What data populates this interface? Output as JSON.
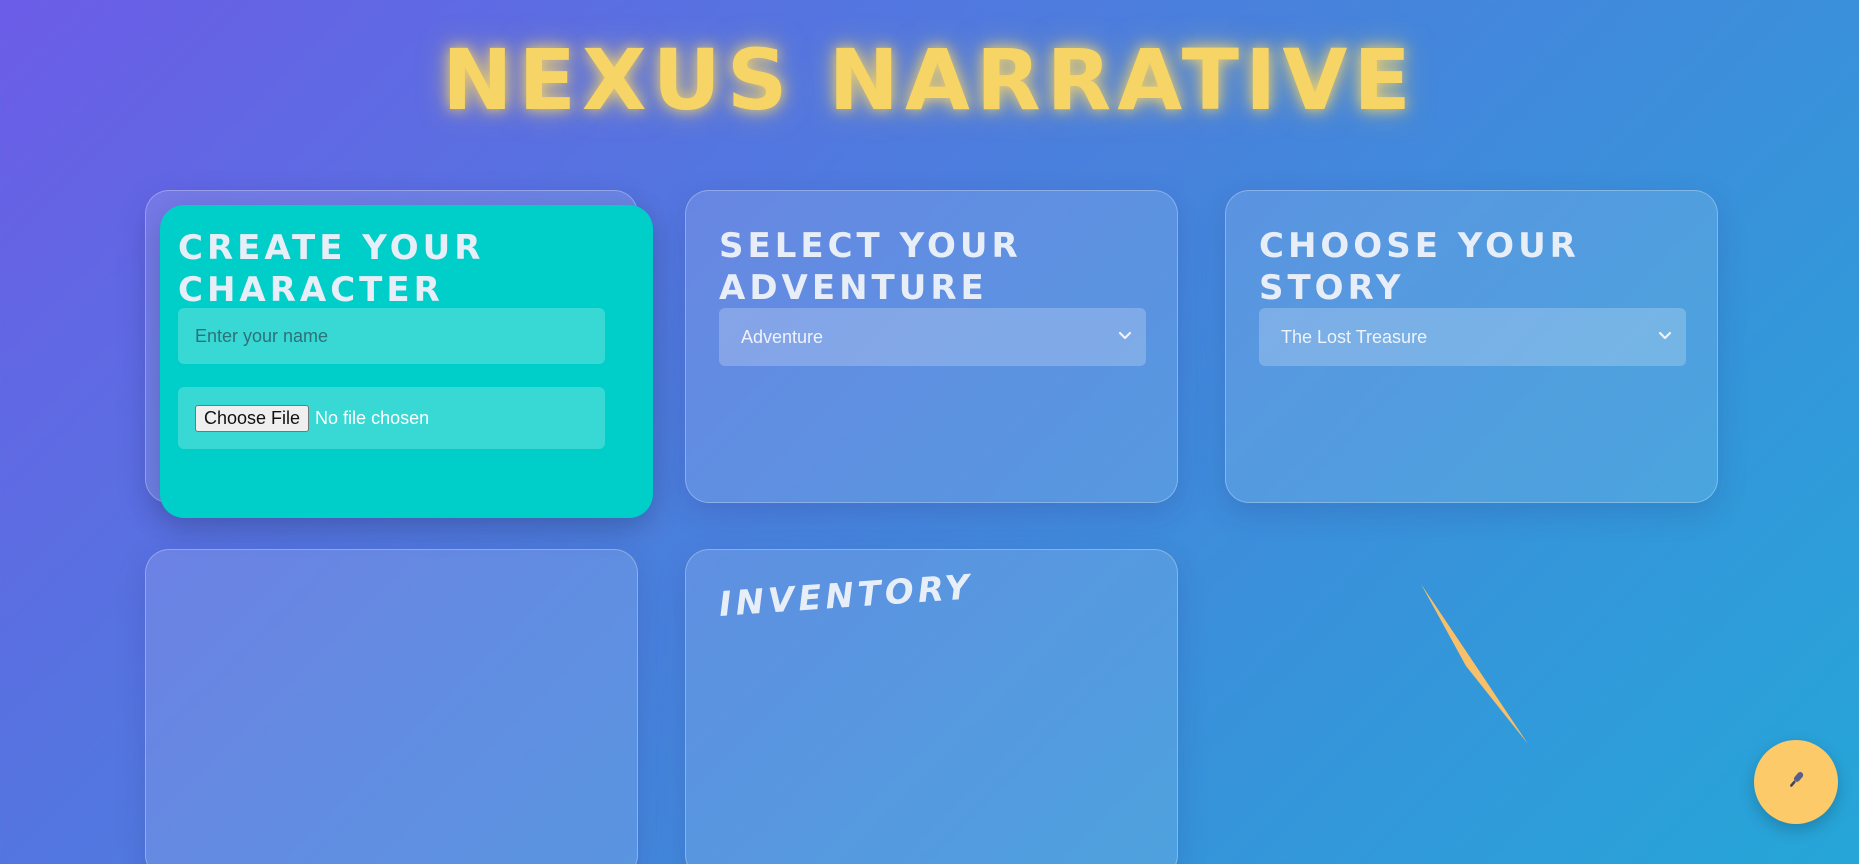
{
  "app": {
    "title": "NEXUS NARRATIVE"
  },
  "character_panel": {
    "heading": "CREATE YOUR CHARACTER",
    "name_placeholder": "Enter your name",
    "name_value": "",
    "file_button_label": "Choose File",
    "file_status": "No file chosen"
  },
  "adventure_panel": {
    "heading": "SELECT YOUR ADVENTURE",
    "selected": "Adventure"
  },
  "story_panel": {
    "heading": "CHOOSE YOUR STORY",
    "selected": "The Lost Treasure"
  },
  "inventory_panel": {
    "heading": "INVENTORY"
  },
  "mic_button": {
    "icon": "microphone-icon"
  },
  "colors": {
    "title_glow": "#f6d465",
    "active_panel": "#00cec9",
    "fab": "#fdca6a",
    "shard": "#f9c06a"
  }
}
